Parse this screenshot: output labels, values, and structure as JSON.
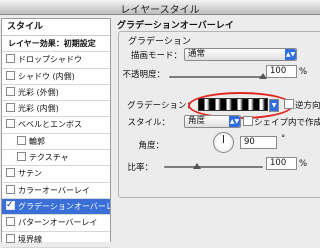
{
  "window": {
    "title": "レイヤースタイル"
  },
  "sidebar": {
    "header": "スタイル",
    "items": [
      {
        "label": "レイヤー効果：初期設定",
        "checkbox": false,
        "checked": false,
        "sub": false
      },
      {
        "label": "ドロップシャドウ",
        "checkbox": true,
        "checked": false,
        "sub": false
      },
      {
        "label": "シャドウ (内側)",
        "checkbox": true,
        "checked": false,
        "sub": false
      },
      {
        "label": "光彩 (外側)",
        "checkbox": true,
        "checked": false,
        "sub": false
      },
      {
        "label": "光彩 (内側)",
        "checkbox": true,
        "checked": false,
        "sub": false
      },
      {
        "label": "ベベルとエンボス",
        "checkbox": true,
        "checked": false,
        "sub": false
      },
      {
        "label": "輪郭",
        "checkbox": true,
        "checked": false,
        "sub": true
      },
      {
        "label": "テクスチャ",
        "checkbox": true,
        "checked": false,
        "sub": true
      },
      {
        "label": "サテン",
        "checkbox": true,
        "checked": false,
        "sub": false
      },
      {
        "label": "カラーオーバーレイ",
        "checkbox": true,
        "checked": false,
        "sub": false
      },
      {
        "label": "グラデーションオーバーレイ",
        "checkbox": true,
        "checked": true,
        "sub": false,
        "selected": true
      },
      {
        "label": "パターンオーバーレイ",
        "checkbox": true,
        "checked": false,
        "sub": false
      },
      {
        "label": "境界線",
        "checkbox": true,
        "checked": false,
        "sub": false
      }
    ]
  },
  "panel": {
    "section_title": "グラデーションオーバーレイ",
    "group_title": "グラデーション",
    "blend_mode": {
      "label": "描画モード：",
      "value": "通常"
    },
    "opacity": {
      "label": "不透明度：",
      "value": "100",
      "unit": "%",
      "fraction": 1.0
    },
    "gradient": {
      "label": "グラデーション：",
      "reverse_label": "逆方向",
      "reverse_checked": false
    },
    "style": {
      "label": "スタイル：",
      "value": "角度",
      "align_label": "シェイプ内で作成",
      "align_checked": false
    },
    "angle": {
      "label": "角度：",
      "value": "90",
      "unit": "°"
    },
    "scale": {
      "label": "比率：",
      "value": "100",
      "unit": "%",
      "fraction": 0.33
    }
  }
}
